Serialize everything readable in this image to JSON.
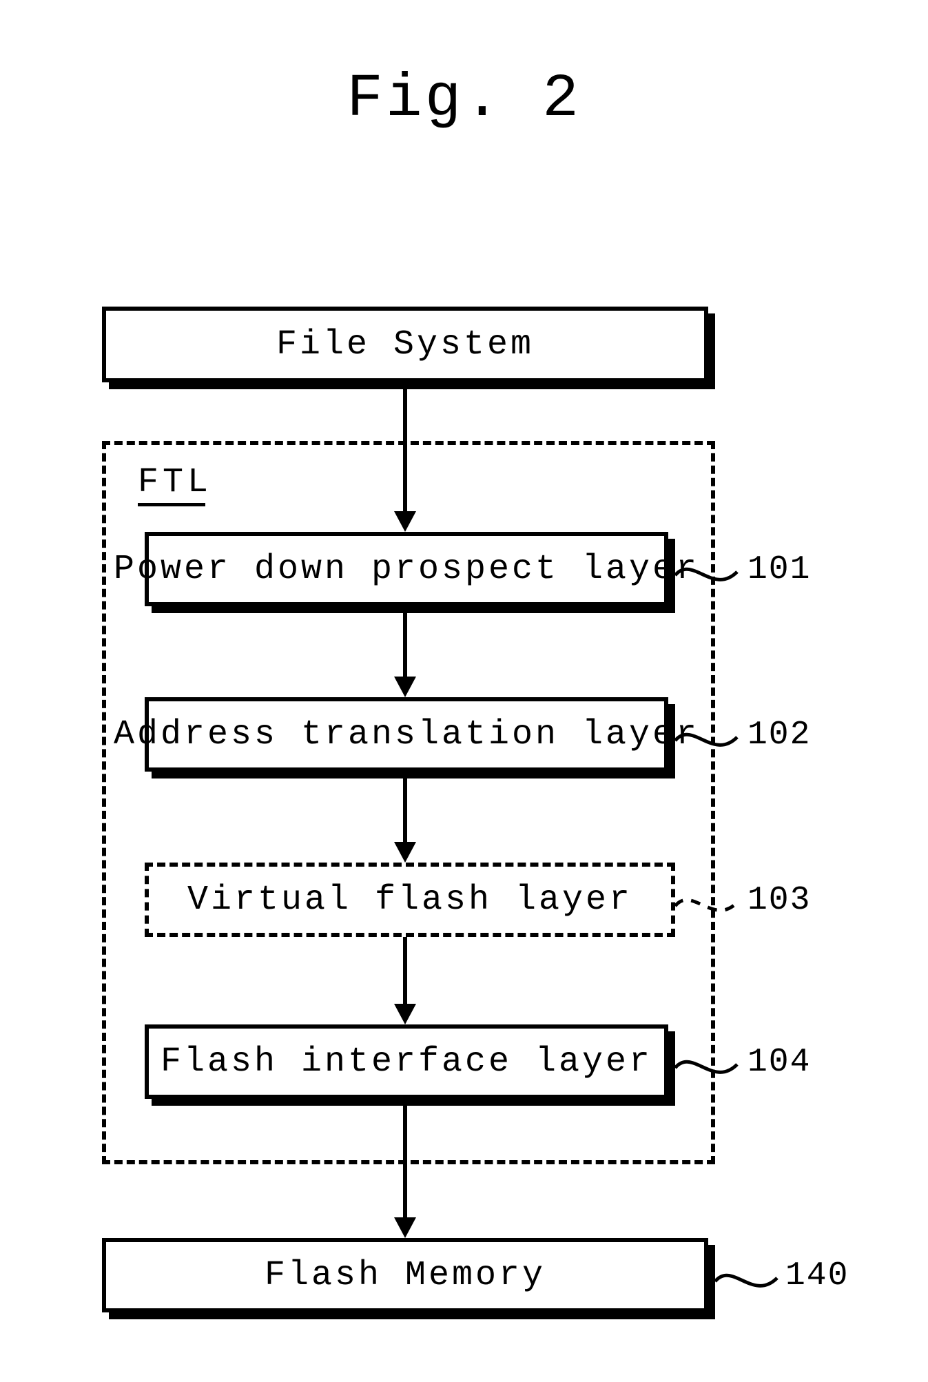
{
  "title": "Fig. 2",
  "blocks": {
    "file_system": "File System",
    "ftl_label": "FTL",
    "power_down": "Power down prospect layer",
    "address_trans": "Address translation layer",
    "virtual_flash": "Virtual flash layer",
    "flash_interface": "Flash interface layer",
    "flash_memory": "Flash Memory"
  },
  "refs": {
    "r101": "101",
    "r102": "102",
    "r103": "103",
    "r104": "104",
    "r140": "140"
  }
}
